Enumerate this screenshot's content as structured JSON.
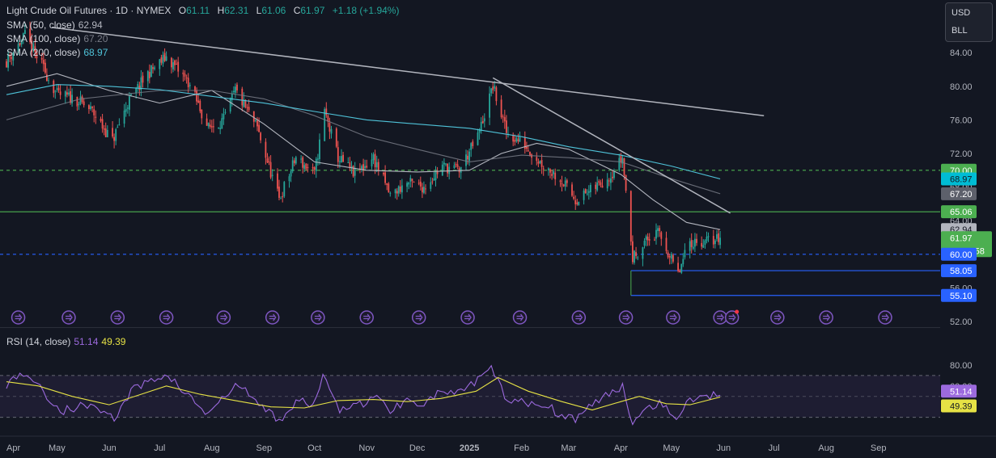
{
  "header": {
    "symbol": "Light Crude Oil Futures · 1D · NYMEX",
    "open_label": "O",
    "open": "61.11",
    "high_label": "H",
    "high": "62.31",
    "low_label": "L",
    "low": "61.06",
    "close_label": "C",
    "close": "61.97",
    "change": "+1.18 (+1.94%)"
  },
  "indicators": {
    "sma50": {
      "label": "SMA (50, close)",
      "value": "62.94"
    },
    "sma100": {
      "label": "SMA (100, close)",
      "value": "67.20"
    },
    "sma200": {
      "label": "SMA (200, close)",
      "value": "68.97"
    },
    "rsi": {
      "label": "RSI (14, close)",
      "value": "51.14",
      "ma_value": "49.39"
    }
  },
  "units": {
    "currency": "USD",
    "unit": "BLL"
  },
  "colors": {
    "up": "#26a69a",
    "down": "#ef5350",
    "sma50": "#b2b5be",
    "sma100": "#787b86",
    "sma200": "#4fc3d9",
    "rsi": "#9c6ade",
    "rsi_ma": "#e6e245",
    "support": "#4caf50",
    "level_blue": "#2962ff",
    "event": "#7e57c2"
  },
  "chart_data": [
    {
      "type": "candlestick",
      "title": "Light Crude Oil Futures · 1D · NYMEX",
      "x_range": [
        "2024-04-01",
        "2025-09-30"
      ],
      "ylim": [
        52,
        88
      ],
      "price_axis_ticks": [
        52.0,
        56.0,
        60.0,
        64.0,
        68.0,
        72.0,
        76.0,
        80.0,
        84.0
      ],
      "time_axis_labels": [
        "Apr",
        "May",
        "Jun",
        "Jul",
        "Aug",
        "Sep",
        "Oct",
        "Nov",
        "Dec",
        "2025",
        "Feb",
        "Mar",
        "Apr",
        "May",
        "Jun",
        "Jul",
        "Aug",
        "Sep"
      ],
      "last_bar": {
        "open": 61.11,
        "high": 62.31,
        "low": 61.06,
        "close": 61.97,
        "change": 1.18,
        "change_pct": 1.94
      },
      "price_path": [
        [
          "2024-04-01",
          83.0
        ],
        [
          "2024-04-12",
          86.0
        ],
        [
          "2024-04-22",
          82.5
        ],
        [
          "2024-05-01",
          79.0
        ],
        [
          "2024-05-12",
          78.5
        ],
        [
          "2024-05-22",
          77.0
        ],
        [
          "2024-06-03",
          73.5
        ],
        [
          "2024-06-12",
          78.0
        ],
        [
          "2024-06-24",
          81.5
        ],
        [
          "2024-07-05",
          83.5
        ],
        [
          "2024-07-18",
          80.5
        ],
        [
          "2024-07-30",
          75.0
        ],
        [
          "2024-08-08",
          76.0
        ],
        [
          "2024-08-15",
          79.5
        ],
        [
          "2024-08-28",
          75.0
        ],
        [
          "2024-09-10",
          66.5
        ],
        [
          "2024-09-20",
          71.5
        ],
        [
          "2024-10-01",
          69.5
        ],
        [
          "2024-10-07",
          77.0
        ],
        [
          "2024-10-15",
          71.5
        ],
        [
          "2024-10-25",
          69.5
        ],
        [
          "2024-11-05",
          71.5
        ],
        [
          "2024-11-15",
          67.0
        ],
        [
          "2024-11-25",
          68.5
        ],
        [
          "2024-12-05",
          68.0
        ],
        [
          "2024-12-16",
          70.5
        ],
        [
          "2024-12-26",
          70.0
        ],
        [
          "2025-01-06",
          74.0
        ],
        [
          "2025-01-15",
          80.0
        ],
        [
          "2025-01-23",
          74.5
        ],
        [
          "2025-02-03",
          73.0
        ],
        [
          "2025-02-12",
          71.0
        ],
        [
          "2025-02-24",
          69.0
        ],
        [
          "2025-03-05",
          66.5
        ],
        [
          "2025-03-14",
          67.5
        ],
        [
          "2025-03-26",
          69.5
        ],
        [
          "2025-04-02",
          71.5
        ],
        [
          "2025-04-08",
          59.5
        ],
        [
          "2025-04-15",
          61.5
        ],
        [
          "2025-04-24",
          62.5
        ],
        [
          "2025-05-05",
          57.5
        ],
        [
          "2025-05-12",
          61.5
        ],
        [
          "2025-05-22",
          61.5
        ],
        [
          "2025-05-30",
          61.97
        ]
      ],
      "series": [
        {
          "name": "SMA (50, close)",
          "last": 62.94,
          "values": [
            [
              "2024-04-01",
              80.0
            ],
            [
              "2024-05-01",
              81.5
            ],
            [
              "2024-06-01",
              79.5
            ],
            [
              "2024-07-01",
              78.0
            ],
            [
              "2024-08-01",
              79.5
            ],
            [
              "2024-09-01",
              75.5
            ],
            [
              "2024-10-01",
              71.0
            ],
            [
              "2024-11-01",
              70.0
            ],
            [
              "2024-12-01",
              69.8
            ],
            [
              "2025-01-01",
              70.0
            ],
            [
              "2025-01-20",
              72.0
            ],
            [
              "2025-02-10",
              73.2
            ],
            [
              "2025-03-01",
              72.5
            ],
            [
              "2025-04-01",
              69.5
            ],
            [
              "2025-04-20",
              66.5
            ],
            [
              "2025-05-10",
              63.8
            ],
            [
              "2025-05-30",
              62.94
            ]
          ]
        },
        {
          "name": "SMA (100, close)",
          "last": 67.2,
          "values": [
            [
              "2024-04-01",
              76.0
            ],
            [
              "2024-05-15",
              78.5
            ],
            [
              "2024-07-01",
              79.5
            ],
            [
              "2024-08-01",
              79.5
            ],
            [
              "2024-09-01",
              78.5
            ],
            [
              "2024-10-01",
              76.5
            ],
            [
              "2024-11-01",
              74.0
            ],
            [
              "2024-12-01",
              72.5
            ],
            [
              "2025-01-01",
              71.0
            ],
            [
              "2025-02-01",
              71.8
            ],
            [
              "2025-03-01",
              71.5
            ],
            [
              "2025-04-01",
              71.0
            ],
            [
              "2025-05-01",
              69.0
            ],
            [
              "2025-05-30",
              67.2
            ]
          ]
        },
        {
          "name": "SMA (200, close)",
          "last": 68.97,
          "values": [
            [
              "2024-04-01",
              79.0
            ],
            [
              "2024-05-01",
              80.2
            ],
            [
              "2024-06-01",
              80.0
            ],
            [
              "2024-07-01",
              79.6
            ],
            [
              "2024-08-01",
              78.8
            ],
            [
              "2024-09-01",
              78.0
            ],
            [
              "2024-10-01",
              77.0
            ],
            [
              "2024-11-01",
              76.0
            ],
            [
              "2024-12-01",
              75.5
            ],
            [
              "2025-01-01",
              75.0
            ],
            [
              "2025-02-01",
              74.0
            ],
            [
              "2025-03-01",
              72.8
            ],
            [
              "2025-04-01",
              71.8
            ],
            [
              "2025-05-01",
              70.5
            ],
            [
              "2025-05-30",
              68.97
            ]
          ]
        }
      ],
      "trendlines": [
        {
          "from": [
            "2024-04-28",
            87.0
          ],
          "to": [
            "2025-06-25",
            76.5
          ]
        },
        {
          "from": [
            "2025-01-15",
            81.0
          ],
          "to": [
            "2025-06-05",
            64.9
          ]
        }
      ],
      "horizontal_levels": [
        {
          "value": 70.0,
          "style": "dashed",
          "label": "70.00"
        },
        {
          "value": 65.06,
          "style": "solid",
          "label": "65.06"
        },
        {
          "value": 60.0,
          "style": "dashed",
          "label": "60.00"
        },
        {
          "value": 58.05,
          "style": "solid",
          "label": "58.05"
        },
        {
          "value": 55.1,
          "style": "solid",
          "label": "55.10"
        }
      ],
      "price_labels": [
        {
          "value": "70.00"
        },
        {
          "value": "68.97"
        },
        {
          "value": "67.20"
        },
        {
          "value": "65.06"
        },
        {
          "value": "62.94"
        },
        {
          "value": "61.97"
        },
        {
          "value": "22:33:58"
        },
        {
          "value": "60.00"
        },
        {
          "value": "58.05"
        },
        {
          "value": "55.10"
        }
      ],
      "event_markers": [
        "2024-04-08",
        "2024-05-08",
        "2024-06-06",
        "2024-07-05",
        "2024-08-08",
        "2024-09-06",
        "2024-10-03",
        "2024-11-01",
        "2024-12-02",
        "2024-12-31",
        "2025-01-31",
        "2025-03-07",
        "2025-04-04",
        "2025-05-02",
        "2025-05-30",
        "2025-06-06",
        "2025-07-03",
        "2025-08-01",
        "2025-09-05"
      ],
      "event_marker_unread": "2025-06-06"
    },
    {
      "type": "line",
      "title": "RSI (14, close)",
      "ylim": [
        0,
        100
      ],
      "axis_ticks": [
        80.0,
        60.0,
        40.0
      ],
      "bands": [
        70,
        50,
        30
      ],
      "series": [
        {
          "name": "RSI (14, close)",
          "last": 51.14,
          "values": [
            [
              "2024-04-01",
              62
            ],
            [
              "2024-04-12",
              74
            ],
            [
              "2024-04-24",
              52
            ],
            [
              "2024-05-03",
              36
            ],
            [
              "2024-05-14",
              40
            ],
            [
              "2024-05-24",
              42
            ],
            [
              "2024-06-04",
              28
            ],
            [
              "2024-06-14",
              55
            ],
            [
              "2024-06-25",
              64
            ],
            [
              "2024-07-05",
              72
            ],
            [
              "2024-07-17",
              52
            ],
            [
              "2024-07-29",
              33
            ],
            [
              "2024-08-07",
              46
            ],
            [
              "2024-08-16",
              62
            ],
            [
              "2024-08-28",
              44
            ],
            [
              "2024-09-10",
              27
            ],
            [
              "2024-09-20",
              45
            ],
            [
              "2024-10-01",
              42
            ],
            [
              "2024-10-07",
              72
            ],
            [
              "2024-10-16",
              38
            ],
            [
              "2024-10-25",
              40
            ],
            [
              "2024-11-06",
              50
            ],
            [
              "2024-11-15",
              37
            ],
            [
              "2024-11-25",
              47
            ],
            [
              "2024-12-05",
              44
            ],
            [
              "2024-12-16",
              55
            ],
            [
              "2024-12-26",
              52
            ],
            [
              "2025-01-07",
              66
            ],
            [
              "2025-01-15",
              77
            ],
            [
              "2025-01-23",
              46
            ],
            [
              "2025-02-03",
              43
            ],
            [
              "2025-02-12",
              45
            ],
            [
              "2025-02-24",
              33
            ],
            [
              "2025-03-05",
              29
            ],
            [
              "2025-03-14",
              41
            ],
            [
              "2025-03-26",
              53
            ],
            [
              "2025-04-02",
              61
            ],
            [
              "2025-04-08",
              24
            ],
            [
              "2025-04-15",
              40
            ],
            [
              "2025-04-24",
              44
            ],
            [
              "2025-05-05",
              30
            ],
            [
              "2025-05-12",
              46
            ],
            [
              "2025-05-22",
              51
            ],
            [
              "2025-05-30",
              51.14
            ]
          ]
        },
        {
          "name": "RSI-based MA",
          "last": 49.39,
          "values": [
            [
              "2024-04-01",
              64
            ],
            [
              "2024-04-20",
              60
            ],
            [
              "2024-05-10",
              50
            ],
            [
              "2024-06-01",
              42
            ],
            [
              "2024-06-20",
              52
            ],
            [
              "2024-07-05",
              60
            ],
            [
              "2024-07-25",
              52
            ],
            [
              "2024-08-15",
              46
            ],
            [
              "2024-09-05",
              40
            ],
            [
              "2024-09-25",
              39
            ],
            [
              "2024-10-15",
              46
            ],
            [
              "2024-11-05",
              47
            ],
            [
              "2024-11-25",
              45
            ],
            [
              "2024-12-15",
              48
            ],
            [
              "2025-01-05",
              55
            ],
            [
              "2025-01-18",
              68
            ],
            [
              "2025-02-05",
              55
            ],
            [
              "2025-02-25",
              45
            ],
            [
              "2025-03-15",
              37
            ],
            [
              "2025-04-01",
              45
            ],
            [
              "2025-04-12",
              50
            ],
            [
              "2025-04-28",
              43
            ],
            [
              "2025-05-12",
              42
            ],
            [
              "2025-05-30",
              49.39
            ]
          ]
        }
      ]
    }
  ]
}
